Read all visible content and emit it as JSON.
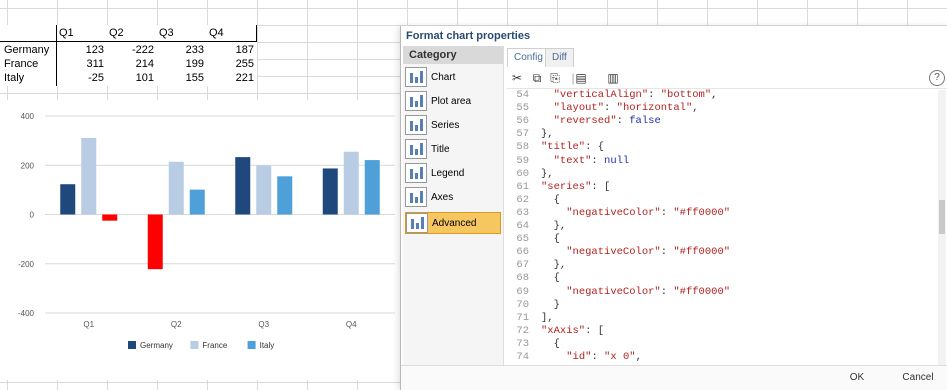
{
  "sheet": {
    "quarters": [
      "Q1",
      "Q2",
      "Q3",
      "Q4"
    ],
    "rows": [
      {
        "country": "Germany",
        "values": [
          "123",
          "-222",
          "233",
          "187"
        ]
      },
      {
        "country": "France",
        "values": [
          "311",
          "214",
          "199",
          "255"
        ]
      },
      {
        "country": "Italy",
        "values": [
          "-25",
          "101",
          "155",
          "221"
        ]
      }
    ]
  },
  "chart_data": {
    "type": "bar",
    "categories": [
      "Q1",
      "Q2",
      "Q3",
      "Q4"
    ],
    "series": [
      {
        "name": "Germany",
        "values": [
          123,
          -222,
          233,
          187
        ],
        "color": "#1f497d"
      },
      {
        "name": "France",
        "values": [
          311,
          214,
          199,
          255
        ],
        "color": "#b8cce4"
      },
      {
        "name": "Italy",
        "values": [
          -25,
          101,
          155,
          221
        ],
        "color": "#4f9fd8"
      }
    ],
    "negative_color": "#ff0000",
    "ylim": [
      -400,
      400
    ],
    "yticks": [
      "400",
      "200",
      "0",
      "-200",
      "-400"
    ],
    "legend_position": "bottom"
  },
  "dialog": {
    "title": "Format chart properties",
    "category_header": "Category",
    "categories": [
      "Chart",
      "Plot area",
      "Series",
      "Title",
      "Legend",
      "Axes",
      "Advanced"
    ],
    "active_category": "Advanced",
    "tabs": {
      "config": "Config",
      "diff": "Diff"
    },
    "help": "?",
    "code_lines": [
      {
        "n": "54",
        "html": "  <span class=\"k\">\"verticalAlign\"</span><span class=\"p\">: </span><span class=\"s\">\"bottom\"</span><span class=\"p\">,</span>"
      },
      {
        "n": "55",
        "html": "  <span class=\"k\">\"layout\"</span><span class=\"p\">: </span><span class=\"s\">\"horizontal\"</span><span class=\"p\">,</span>"
      },
      {
        "n": "56",
        "html": "  <span class=\"k\">\"reversed\"</span><span class=\"p\">: </span><span class=\"b\">false</span>"
      },
      {
        "n": "57",
        "html": "<span class=\"p\">},</span>"
      },
      {
        "n": "58",
        "html": "<span class=\"k\">\"title\"</span><span class=\"p\">: {</span>"
      },
      {
        "n": "59",
        "html": "  <span class=\"k\">\"text\"</span><span class=\"p\">: </span><span class=\"b\">null</span>"
      },
      {
        "n": "60",
        "html": "<span class=\"p\">},</span>"
      },
      {
        "n": "61",
        "html": "<span class=\"k\">\"series\"</span><span class=\"p\">: [</span>"
      },
      {
        "n": "62",
        "html": "  <span class=\"p\">{</span>"
      },
      {
        "n": "63",
        "html": "    <span class=\"k\">\"negativeColor\"</span><span class=\"p\">: </span><span class=\"s\">\"#ff0000\"</span>"
      },
      {
        "n": "64",
        "html": "  <span class=\"p\">},</span>"
      },
      {
        "n": "65",
        "html": "  <span class=\"p\">{</span>"
      },
      {
        "n": "66",
        "html": "    <span class=\"k\">\"negativeColor\"</span><span class=\"p\">: </span><span class=\"s\">\"#ff0000\"</span>"
      },
      {
        "n": "67",
        "html": "  <span class=\"p\">},</span>"
      },
      {
        "n": "68",
        "html": "  <span class=\"p\">{</span>"
      },
      {
        "n": "69",
        "html": "    <span class=\"k\">\"negativeColor\"</span><span class=\"p\">: </span><span class=\"s\">\"#ff0000\"</span>"
      },
      {
        "n": "70",
        "html": "  <span class=\"p\">}</span>"
      },
      {
        "n": "71",
        "html": "<span class=\"p\">],</span>"
      },
      {
        "n": "72",
        "html": "<span class=\"k\">\"xAxis\"</span><span class=\"p\">: [</span>"
      },
      {
        "n": "73",
        "html": "  <span class=\"p\">{</span>"
      },
      {
        "n": "74",
        "html": "    <span class=\"k\">\"id\"</span><span class=\"p\">: </span><span class=\"s\">\"x 0\"</span><span class=\"p\">,</span>"
      }
    ],
    "buttons": {
      "ok": "OK",
      "cancel": "Cancel"
    }
  }
}
